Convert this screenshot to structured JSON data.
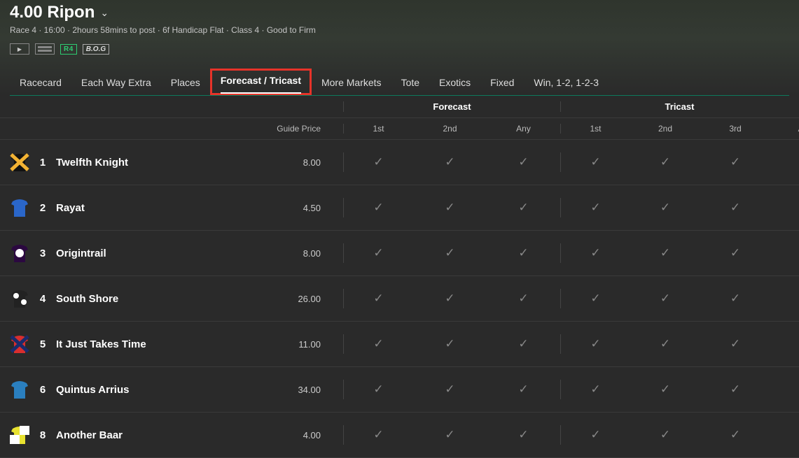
{
  "header": {
    "title": "4.00 Ripon",
    "subtitle": "Race 4 · 16:00 · 2hours 58mins to post · 6f Handicap Flat · Class 4 · Good to Firm",
    "r4": "R4",
    "bog": "B.O.G"
  },
  "tabs": [
    {
      "label": "Racecard",
      "active": false
    },
    {
      "label": "Each Way Extra",
      "active": false
    },
    {
      "label": "Places",
      "active": false
    },
    {
      "label": "Forecast / Tricast",
      "active": true
    },
    {
      "label": "More Markets",
      "active": false
    },
    {
      "label": "Tote",
      "active": false
    },
    {
      "label": "Exotics",
      "active": false
    },
    {
      "label": "Fixed",
      "active": false
    },
    {
      "label": "Win, 1-2, 1-2-3",
      "active": false
    }
  ],
  "sections": {
    "forecast": "Forecast",
    "tricast": "Tricast"
  },
  "columns": {
    "guide": "Guide Price",
    "f1": "1st",
    "f2": "2nd",
    "fany": "Any",
    "t1": "1st",
    "t2": "2nd",
    "t3": "3rd",
    "tany": "Any"
  },
  "runners": [
    {
      "num": "1",
      "name": "Twelfth Knight",
      "price": "8.00",
      "silk": {
        "bg": "#111",
        "fg": "#f2b233",
        "shape": "cross"
      }
    },
    {
      "num": "2",
      "name": "Rayat",
      "price": "4.50",
      "silk": {
        "bg": "#2a66c9",
        "fg": "#1c4aa0",
        "shape": "plain"
      }
    },
    {
      "num": "3",
      "name": "Origintrail",
      "price": "8.00",
      "silk": {
        "bg": "#2b0840",
        "fg": "#ffffff",
        "shape": "disc"
      }
    },
    {
      "num": "4",
      "name": "South Shore",
      "price": "26.00",
      "silk": {
        "bg": "#222",
        "fg": "#ffffff",
        "shape": "spots"
      }
    },
    {
      "num": "5",
      "name": "It Just Takes Time",
      "price": "11.00",
      "silk": {
        "bg": "#d82e2e",
        "fg": "#1a2b6d",
        "shape": "cross"
      }
    },
    {
      "num": "6",
      "name": "Quintus Arrius",
      "price": "34.00",
      "silk": {
        "bg": "#2a7fbf",
        "fg": "#1d5d8f",
        "shape": "plain"
      }
    },
    {
      "num": "8",
      "name": "Another Baar",
      "price": "4.00",
      "silk": {
        "bg": "#e8e230",
        "fg": "#ffffff",
        "shape": "quarter"
      }
    }
  ]
}
